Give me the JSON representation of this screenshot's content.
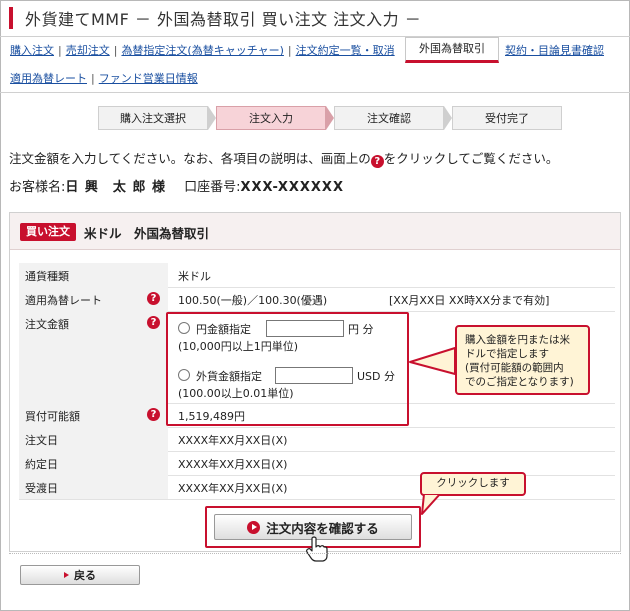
{
  "page": {
    "title": "外貨建てMMF － 外国為替取引 買い注文 注文入力 －"
  },
  "nav": {
    "row1": [
      "購入注文",
      "売却注文",
      "為替指定注文(為替キャッチャー)",
      "注文約定一覧・取消"
    ],
    "active_tab": "外国為替取引",
    "after_tab": "契約・目論見書確認",
    "row2": [
      "適用為替レート",
      "ファンド営業日情報"
    ]
  },
  "steps": [
    "購入注文選択",
    "注文入力",
    "注文確認",
    "受付完了"
  ],
  "active_step_index": 1,
  "instructions": {
    "before": "注文金額を入力してください。なお、各項目の説明は、画面上の",
    "after": "をクリックしてご覧ください。",
    "icon": "question-icon"
  },
  "customer": {
    "name_label": "お客様名:",
    "name": "日 興　太 郎 様",
    "account_label": "口座番号:",
    "account": "XXX-XXXXXX"
  },
  "order": {
    "badge": "買い注文",
    "title": "米ドル　外国為替取引",
    "rows": {
      "currency": {
        "label": "通貨種類",
        "value": "米ドル"
      },
      "rate": {
        "label": "適用為替レート",
        "value": "100.50(一般)／100.30(優遇)",
        "note": "[XX月XX日 XX時XX分まで有効]"
      },
      "amount": {
        "label": "注文金額",
        "jpy_option": "円金額指定",
        "jpy_unit": "円 分",
        "jpy_hint": "(10,000円以上1円単位)",
        "usd_option": "外貨金額指定",
        "usd_unit": "USD 分",
        "usd_hint": "(100.00以上0.01単位)"
      },
      "buying_power": {
        "label": "買付可能額",
        "value": "1,519,489円"
      },
      "order_date": {
        "label": "注文日",
        "value": "XXXX年XX月XX日(X)"
      },
      "trade_date": {
        "label": "約定日",
        "value": "XXXX年XX月XX日(X)"
      },
      "settle_date": {
        "label": "受渡日",
        "value": "XXXX年XX月XX日(X)"
      }
    }
  },
  "callouts": {
    "amount_note": [
      "購入金額を円または米",
      "ドルで指定します",
      "(買付可能額の範囲内",
      "でのご指定となります)"
    ],
    "click_note": "クリックします"
  },
  "buttons": {
    "confirm": "注文内容を確認する",
    "back": "戻る"
  },
  "colors": {
    "accent": "#c8102e",
    "link": "#1a4fa0",
    "callout_bg": "#fff4d6"
  }
}
